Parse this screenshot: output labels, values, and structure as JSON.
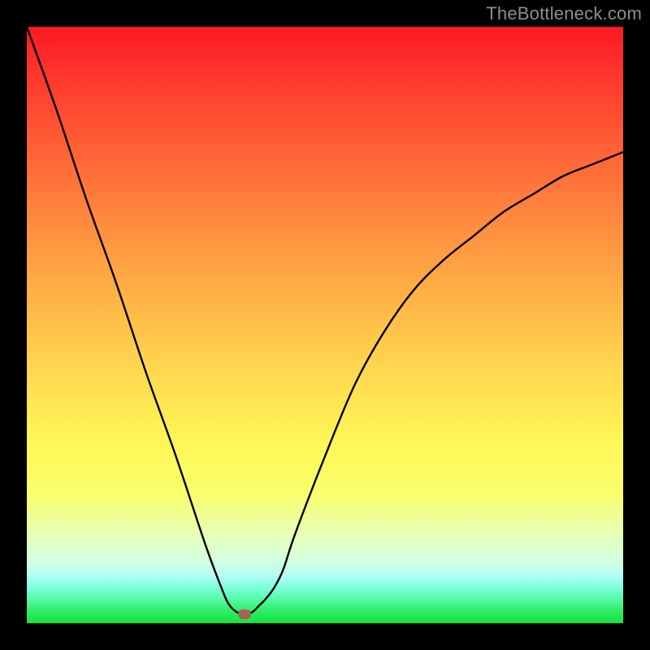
{
  "watermark": {
    "text": "TheBottleneck.com"
  },
  "chart_data": {
    "type": "line",
    "title": "",
    "xlabel": "",
    "ylabel": "",
    "xlim": [
      0,
      100
    ],
    "ylim": [
      0,
      100
    ],
    "grid": false,
    "legend": false,
    "curve_color": "#000000",
    "gradient_stops": [
      {
        "pct": 0,
        "color": "#fe1825"
      },
      {
        "pct": 10,
        "color": "#ff3d2e"
      },
      {
        "pct": 22,
        "color": "#ff6637"
      },
      {
        "pct": 34,
        "color": "#ff8f3f"
      },
      {
        "pct": 46,
        "color": "#ffb547"
      },
      {
        "pct": 58,
        "color": "#ffd950"
      },
      {
        "pct": 70,
        "color": "#fff758"
      },
      {
        "pct": 78,
        "color": "#f9ff6a"
      },
      {
        "pct": 84,
        "color": "#eaffaa"
      },
      {
        "pct": 89,
        "color": "#d6ffdc"
      },
      {
        "pct": 92,
        "color": "#b5fff2"
      },
      {
        "pct": 94,
        "color": "#7cffde"
      },
      {
        "pct": 96,
        "color": "#55f9a4"
      },
      {
        "pct": 98,
        "color": "#2eed64"
      },
      {
        "pct": 100,
        "color": "#14e53a"
      }
    ],
    "series": [
      {
        "name": "bottleneck-curve",
        "x": [
          0,
          5,
          10,
          15,
          20,
          25,
          30,
          33,
          34,
          35,
          36,
          37,
          38,
          39,
          40,
          41.5,
          43,
          45,
          50,
          55,
          60,
          65,
          70,
          75,
          80,
          85,
          90,
          95,
          100
        ],
        "y": [
          100,
          86,
          71,
          57,
          42,
          28,
          13,
          5,
          3,
          2,
          1.5,
          1.5,
          2,
          3,
          4,
          6,
          9,
          15,
          28,
          40,
          49,
          56,
          61,
          65,
          69,
          72,
          75,
          77,
          79
        ]
      }
    ],
    "marker": {
      "name": "optimal-point",
      "x": 36.5,
      "y": 1.5,
      "color": "#ab6056"
    }
  }
}
